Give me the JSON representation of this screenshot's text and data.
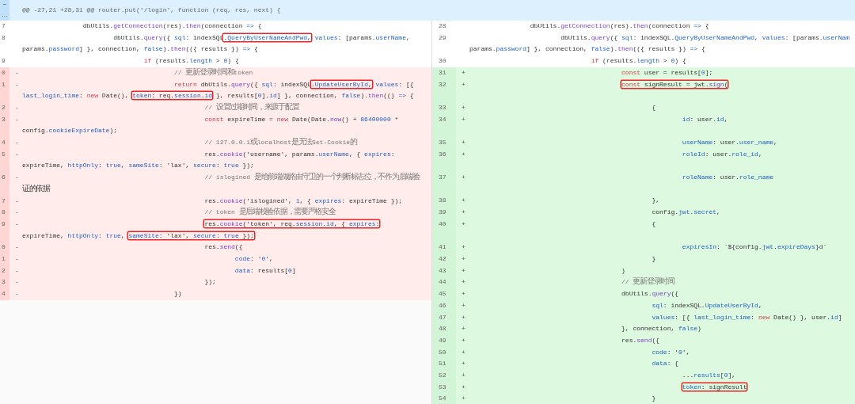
{
  "hunk_header": {
    "text": "@@ -27,21 +28,31 @@ router.put('/login', function (req, res, next) {"
  },
  "left": {
    "rows": [
      {
        "number": "7",
        "kind": "context",
        "lines": [
          "\t\tdbUtils.getConnection(res).then(connection => {"
        ]
      },
      {
        "number": "8",
        "kind": "context",
        "lines": [
          [
            {
              "text": "\t\t\tdbUtils.query({ sql: indexSQL"
            },
            {
              "text": ".QueryByUserNameAndPwd,",
              "boxed": true
            },
            {
              "text": " values: [params.userName,"
            }
          ],
          "params.password] }, connection, false).then(({ results }) => {"
        ]
      },
      {
        "number": "9",
        "kind": "context",
        "lines": [
          "\t\t\t\tif (results.length > 0) {"
        ]
      },
      {
        "number": "0",
        "kind": "removed",
        "sign": "-",
        "lines": [
          "\t\t\t\t\t// 更新登录时间和token"
        ]
      },
      {
        "number": "1",
        "kind": "removed",
        "sign": "-",
        "lines": [
          [
            {
              "text": "\t\t\t\t\treturn dbUtils.query({ sql: indexSQL"
            },
            {
              "text": ".UpdateUserById,",
              "boxed": true
            },
            {
              "text": " values: [{"
            }
          ],
          [
            {
              "text": "last_login_time: new Date(), "
            },
            {
              "text": "token: req.session.id",
              "boxed": true
            },
            {
              "text": " }, results[0].id] }, connection, false).then(() => {"
            }
          ]
        ]
      },
      {
        "number": "2",
        "kind": "removed",
        "sign": "-",
        "lines": [
          "\t\t\t\t\t\t// 设置过期时间，来源于配置"
        ]
      },
      {
        "number": "3",
        "kind": "removed",
        "sign": "-",
        "lines": [
          "\t\t\t\t\t\tconst expireTime = new Date(Date.now() + 86400000 *",
          "config.cookieExpireDate);"
        ]
      },
      {
        "number": "4",
        "kind": "removed",
        "sign": "-",
        "lines": [
          "\t\t\t\t\t\t// 127.0.0.1或localhost是无法Set-Cookie的"
        ]
      },
      {
        "number": "5",
        "kind": "removed",
        "sign": "-",
        "lines": [
          "\t\t\t\t\t\tres.cookie('username', params.userName, { expires:",
          "expireTime, httpOnly: true, sameSite: 'lax', secure: true });"
        ]
      },
      {
        "number": "6",
        "kind": "removed",
        "sign": "-",
        "lines": [
          "\t\t\t\t\t\t// islogined 是给前端做路由守卫的一个判断标志位，不作为后端验",
          "证的依据"
        ]
      },
      {
        "number": "7",
        "kind": "removed",
        "sign": "-",
        "lines": [
          "\t\t\t\t\t\tres.cookie('islogined', 1, { expires: expireTime });"
        ]
      },
      {
        "number": "8",
        "kind": "removed",
        "sign": "-",
        "lines": [
          "\t\t\t\t\t\t// token 是后端校验依据，需要严格安全"
        ]
      },
      {
        "number": "9",
        "kind": "removed",
        "sign": "-",
        "lines": [
          [
            {
              "text": "\t\t\t\t\t\tres.cookie('token', req.session.id, { expires:",
              "boxed": true
            }
          ],
          [
            {
              "text": "expireTime, httpOnly: true, "
            },
            {
              "text": "sameSite: 'lax', secure: true });",
              "boxed": true
            }
          ]
        ]
      },
      {
        "number": "0",
        "kind": "removed",
        "sign": "-",
        "lines": [
          "\t\t\t\t\t\tres.send({"
        ]
      },
      {
        "number": "1",
        "kind": "removed",
        "sign": "-",
        "lines": [
          "\t\t\t\t\t\t\tcode: '0',"
        ]
      },
      {
        "number": "2",
        "kind": "removed",
        "sign": "-",
        "lines": [
          "\t\t\t\t\t\t\tdata: results[0]"
        ]
      },
      {
        "number": "3",
        "kind": "removed",
        "sign": "-",
        "lines": [
          "\t\t\t\t\t\t});"
        ]
      },
      {
        "number": "4",
        "kind": "removed",
        "sign": "-",
        "lines": [
          "\t\t\t\t\t})"
        ]
      }
    ]
  },
  "right": {
    "rows": [
      {
        "number": "28",
        "kind": "context",
        "lines": [
          "\t\tdbUtils.getConnection(res).then(connection => {"
        ]
      },
      {
        "number": "29",
        "kind": "context",
        "lines": [
          "\t\t\tdbUtils.query({ sql: indexSQL.QueryByUserNameAndPwd, values: [params.userNam",
          "params.password] }, connection, false).then(({ results }) => {"
        ]
      },
      {
        "number": "30",
        "kind": "context",
        "lines": [
          "\t\t\t\tif (results.length > 0) {"
        ]
      },
      {
        "number": "31",
        "kind": "added",
        "sign": "+",
        "lines": [
          "\t\t\t\t\tconst user = results[0];"
        ]
      },
      {
        "number": "32",
        "kind": "added",
        "sign": "+",
        "spaced": true,
        "lines": [
          [
            {
              "text": "\t\t\t\t\tconst signResult = jwt.sign(",
              "boxed": true
            }
          ]
        ]
      },
      {
        "number": "33",
        "kind": "added",
        "sign": "+",
        "lines": [
          "\t\t\t\t\t\t{"
        ]
      },
      {
        "number": "34",
        "kind": "added",
        "sign": "+",
        "spaced": true,
        "lines": [
          "\t\t\t\t\t\t\tid: user.id,"
        ]
      },
      {
        "number": "35",
        "kind": "added",
        "sign": "+",
        "lines": [
          "\t\t\t\t\t\t\tuserName: user.user_name,"
        ]
      },
      {
        "number": "36",
        "kind": "added",
        "sign": "+",
        "spaced": true,
        "lines": [
          "\t\t\t\t\t\t\troleId: user.role_id,"
        ]
      },
      {
        "number": "37",
        "kind": "added",
        "sign": "+",
        "spaced": true,
        "lines": [
          "\t\t\t\t\t\t\troleName: user.role_name"
        ]
      },
      {
        "number": "38",
        "kind": "added",
        "sign": "+",
        "lines": [
          "\t\t\t\t\t\t},"
        ]
      },
      {
        "number": "39",
        "kind": "added",
        "sign": "+",
        "lines": [
          "\t\t\t\t\t\tconfig.jwt.secret,"
        ]
      },
      {
        "number": "40",
        "kind": "added",
        "sign": "+",
        "spaced": true,
        "lines": [
          "\t\t\t\t\t\t{"
        ]
      },
      {
        "number": "41",
        "kind": "added",
        "sign": "+",
        "lines": [
          "\t\t\t\t\t\t\texpiresIn: `${config.jwt.expireDays}d`"
        ]
      },
      {
        "number": "42",
        "kind": "added",
        "sign": "+",
        "lines": [
          "\t\t\t\t\t\t}"
        ]
      },
      {
        "number": "43",
        "kind": "added",
        "sign": "+",
        "lines": [
          "\t\t\t\t\t)"
        ]
      },
      {
        "number": "44",
        "kind": "added",
        "sign": "+",
        "lines": [
          "\t\t\t\t\t// 更新登录时间"
        ]
      },
      {
        "number": "45",
        "kind": "added",
        "sign": "+",
        "lines": [
          "\t\t\t\t\tdbUtils.query({"
        ]
      },
      {
        "number": "46",
        "kind": "added",
        "sign": "+",
        "lines": [
          "\t\t\t\t\t\tsql: indexSQL.UpdateUserById,"
        ]
      },
      {
        "number": "47",
        "kind": "added",
        "sign": "+",
        "lines": [
          "\t\t\t\t\t\tvalues: [{ last_login_time: new Date() }, user.id]"
        ]
      },
      {
        "number": "48",
        "kind": "added",
        "sign": "+",
        "lines": [
          "\t\t\t\t\t}, connection, false)"
        ]
      },
      {
        "number": "49",
        "kind": "added",
        "sign": "+",
        "lines": [
          "\t\t\t\t\tres.send({"
        ]
      },
      {
        "number": "50",
        "kind": "added",
        "sign": "+",
        "lines": [
          "\t\t\t\t\t\tcode: '0',"
        ]
      },
      {
        "number": "51",
        "kind": "added",
        "sign": "+",
        "lines": [
          "\t\t\t\t\t\tdata: {"
        ]
      },
      {
        "number": "52",
        "kind": "added",
        "sign": "+",
        "lines": [
          "\t\t\t\t\t\t\t...results[0],"
        ]
      },
      {
        "number": "53",
        "kind": "added",
        "sign": "+",
        "lines": [
          [
            {
              "text": "\t\t\t\t\t\t\ttoken: signResult",
              "boxed": true
            }
          ]
        ]
      },
      {
        "number": "54",
        "kind": "added",
        "sign": "+",
        "lines": [
          "\t\t\t\t\t\t}"
        ]
      }
    ]
  }
}
